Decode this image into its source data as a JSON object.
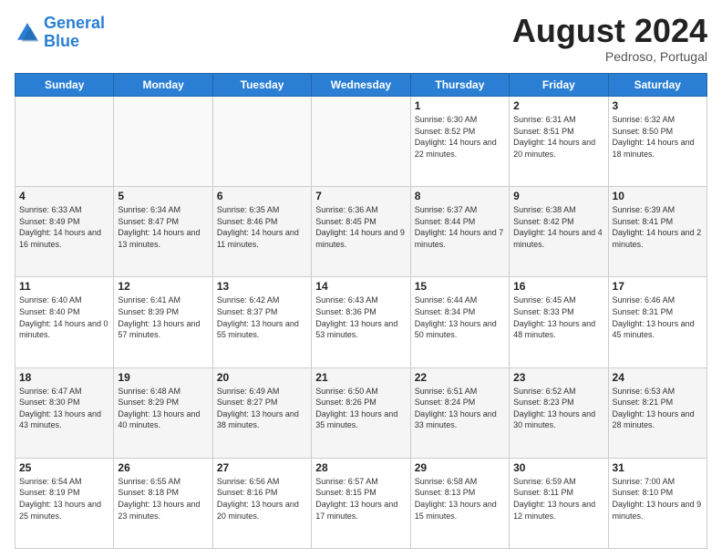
{
  "logo": {
    "line1": "General",
    "line2": "Blue"
  },
  "title": "August 2024",
  "subtitle": "Pedroso, Portugal",
  "days_of_week": [
    "Sunday",
    "Monday",
    "Tuesday",
    "Wednesday",
    "Thursday",
    "Friday",
    "Saturday"
  ],
  "weeks": [
    [
      {
        "day": "",
        "sunrise": "",
        "sunset": "",
        "daylight": ""
      },
      {
        "day": "",
        "sunrise": "",
        "sunset": "",
        "daylight": ""
      },
      {
        "day": "",
        "sunrise": "",
        "sunset": "",
        "daylight": ""
      },
      {
        "day": "",
        "sunrise": "",
        "sunset": "",
        "daylight": ""
      },
      {
        "day": "1",
        "sunrise": "Sunrise: 6:30 AM",
        "sunset": "Sunset: 8:52 PM",
        "daylight": "Daylight: 14 hours and 22 minutes."
      },
      {
        "day": "2",
        "sunrise": "Sunrise: 6:31 AM",
        "sunset": "Sunset: 8:51 PM",
        "daylight": "Daylight: 14 hours and 20 minutes."
      },
      {
        "day": "3",
        "sunrise": "Sunrise: 6:32 AM",
        "sunset": "Sunset: 8:50 PM",
        "daylight": "Daylight: 14 hours and 18 minutes."
      }
    ],
    [
      {
        "day": "4",
        "sunrise": "Sunrise: 6:33 AM",
        "sunset": "Sunset: 8:49 PM",
        "daylight": "Daylight: 14 hours and 16 minutes."
      },
      {
        "day": "5",
        "sunrise": "Sunrise: 6:34 AM",
        "sunset": "Sunset: 8:47 PM",
        "daylight": "Daylight: 14 hours and 13 minutes."
      },
      {
        "day": "6",
        "sunrise": "Sunrise: 6:35 AM",
        "sunset": "Sunset: 8:46 PM",
        "daylight": "Daylight: 14 hours and 11 minutes."
      },
      {
        "day": "7",
        "sunrise": "Sunrise: 6:36 AM",
        "sunset": "Sunset: 8:45 PM",
        "daylight": "Daylight: 14 hours and 9 minutes."
      },
      {
        "day": "8",
        "sunrise": "Sunrise: 6:37 AM",
        "sunset": "Sunset: 8:44 PM",
        "daylight": "Daylight: 14 hours and 7 minutes."
      },
      {
        "day": "9",
        "sunrise": "Sunrise: 6:38 AM",
        "sunset": "Sunset: 8:42 PM",
        "daylight": "Daylight: 14 hours and 4 minutes."
      },
      {
        "day": "10",
        "sunrise": "Sunrise: 6:39 AM",
        "sunset": "Sunset: 8:41 PM",
        "daylight": "Daylight: 14 hours and 2 minutes."
      }
    ],
    [
      {
        "day": "11",
        "sunrise": "Sunrise: 6:40 AM",
        "sunset": "Sunset: 8:40 PM",
        "daylight": "Daylight: 14 hours and 0 minutes."
      },
      {
        "day": "12",
        "sunrise": "Sunrise: 6:41 AM",
        "sunset": "Sunset: 8:39 PM",
        "daylight": "Daylight: 13 hours and 57 minutes."
      },
      {
        "day": "13",
        "sunrise": "Sunrise: 6:42 AM",
        "sunset": "Sunset: 8:37 PM",
        "daylight": "Daylight: 13 hours and 55 minutes."
      },
      {
        "day": "14",
        "sunrise": "Sunrise: 6:43 AM",
        "sunset": "Sunset: 8:36 PM",
        "daylight": "Daylight: 13 hours and 53 minutes."
      },
      {
        "day": "15",
        "sunrise": "Sunrise: 6:44 AM",
        "sunset": "Sunset: 8:34 PM",
        "daylight": "Daylight: 13 hours and 50 minutes."
      },
      {
        "day": "16",
        "sunrise": "Sunrise: 6:45 AM",
        "sunset": "Sunset: 8:33 PM",
        "daylight": "Daylight: 13 hours and 48 minutes."
      },
      {
        "day": "17",
        "sunrise": "Sunrise: 6:46 AM",
        "sunset": "Sunset: 8:31 PM",
        "daylight": "Daylight: 13 hours and 45 minutes."
      }
    ],
    [
      {
        "day": "18",
        "sunrise": "Sunrise: 6:47 AM",
        "sunset": "Sunset: 8:30 PM",
        "daylight": "Daylight: 13 hours and 43 minutes."
      },
      {
        "day": "19",
        "sunrise": "Sunrise: 6:48 AM",
        "sunset": "Sunset: 8:29 PM",
        "daylight": "Daylight: 13 hours and 40 minutes."
      },
      {
        "day": "20",
        "sunrise": "Sunrise: 6:49 AM",
        "sunset": "Sunset: 8:27 PM",
        "daylight": "Daylight: 13 hours and 38 minutes."
      },
      {
        "day": "21",
        "sunrise": "Sunrise: 6:50 AM",
        "sunset": "Sunset: 8:26 PM",
        "daylight": "Daylight: 13 hours and 35 minutes."
      },
      {
        "day": "22",
        "sunrise": "Sunrise: 6:51 AM",
        "sunset": "Sunset: 8:24 PM",
        "daylight": "Daylight: 13 hours and 33 minutes."
      },
      {
        "day": "23",
        "sunrise": "Sunrise: 6:52 AM",
        "sunset": "Sunset: 8:23 PM",
        "daylight": "Daylight: 13 hours and 30 minutes."
      },
      {
        "day": "24",
        "sunrise": "Sunrise: 6:53 AM",
        "sunset": "Sunset: 8:21 PM",
        "daylight": "Daylight: 13 hours and 28 minutes."
      }
    ],
    [
      {
        "day": "25",
        "sunrise": "Sunrise: 6:54 AM",
        "sunset": "Sunset: 8:19 PM",
        "daylight": "Daylight: 13 hours and 25 minutes."
      },
      {
        "day": "26",
        "sunrise": "Sunrise: 6:55 AM",
        "sunset": "Sunset: 8:18 PM",
        "daylight": "Daylight: 13 hours and 23 minutes."
      },
      {
        "day": "27",
        "sunrise": "Sunrise: 6:56 AM",
        "sunset": "Sunset: 8:16 PM",
        "daylight": "Daylight: 13 hours and 20 minutes."
      },
      {
        "day": "28",
        "sunrise": "Sunrise: 6:57 AM",
        "sunset": "Sunset: 8:15 PM",
        "daylight": "Daylight: 13 hours and 17 minutes."
      },
      {
        "day": "29",
        "sunrise": "Sunrise: 6:58 AM",
        "sunset": "Sunset: 8:13 PM",
        "daylight": "Daylight: 13 hours and 15 minutes."
      },
      {
        "day": "30",
        "sunrise": "Sunrise: 6:59 AM",
        "sunset": "Sunset: 8:11 PM",
        "daylight": "Daylight: 13 hours and 12 minutes."
      },
      {
        "day": "31",
        "sunrise": "Sunrise: 7:00 AM",
        "sunset": "Sunset: 8:10 PM",
        "daylight": "Daylight: 13 hours and 9 minutes."
      }
    ]
  ]
}
